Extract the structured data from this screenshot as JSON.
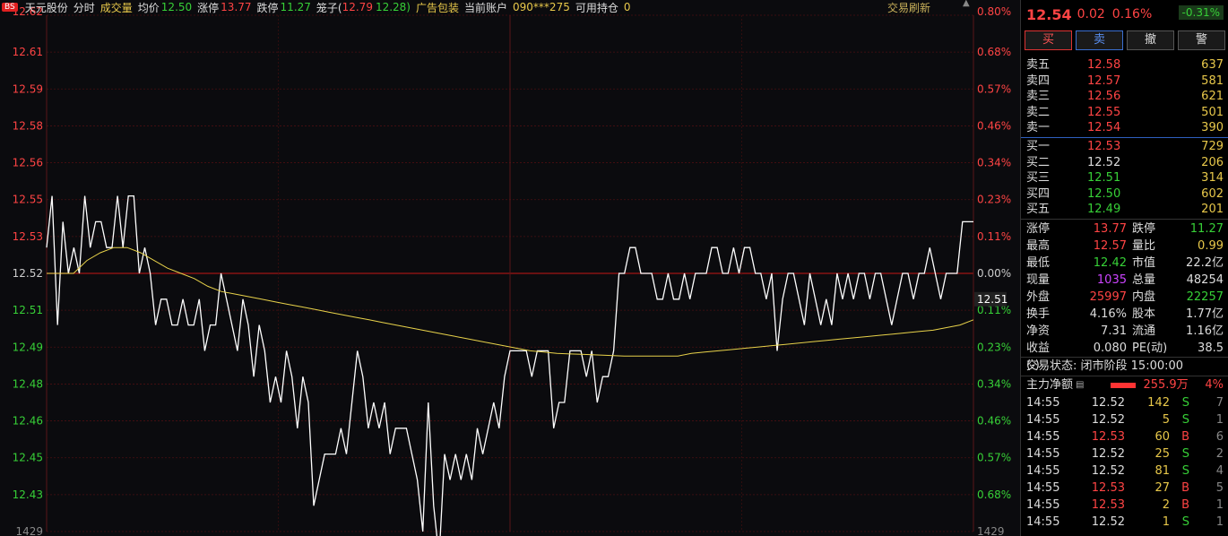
{
  "header": {
    "bs_tag": "BS",
    "stock_name": "天元股份",
    "view_mode": "分时",
    "indicator": "成交量",
    "avg_label": "均价",
    "avg_value": "12.50",
    "limit_up_label": "涨停",
    "limit_up_value": "13.77",
    "limit_down_label": "跌停",
    "limit_down_value": "11.27",
    "cage_label": "笼子(",
    "cage_high": "12.79",
    "cage_low": "12.28)",
    "ad_label": "广告包装",
    "account_label": "当前账户",
    "account_value": "090***275",
    "holding_label": "可用持仓",
    "holding_value": "0",
    "refresh_label": "交易刷新"
  },
  "chart": {
    "left_axis": [
      "12.62",
      "12.61",
      "12.59",
      "12.58",
      "12.56",
      "12.55",
      "12.53",
      "12.52",
      "12.51",
      "12.49",
      "12.48",
      "12.46",
      "12.45",
      "12.43",
      "1429"
    ],
    "right_axis": [
      "0.80%",
      "0.68%",
      "0.57%",
      "0.46%",
      "0.34%",
      "0.23%",
      "0.11%",
      "0.00%",
      "0.11%",
      "0.23%",
      "0.34%",
      "0.46%",
      "0.57%",
      "0.68%",
      "1429"
    ],
    "current_price_tag": "12.51",
    "y_min": 12.42,
    "y_max": 12.62,
    "price_points": [
      12.53,
      12.55,
      12.5,
      12.54,
      12.52,
      12.53,
      12.52,
      12.55,
      12.53,
      12.54,
      12.54,
      12.53,
      12.53,
      12.55,
      12.53,
      12.55,
      12.55,
      12.52,
      12.53,
      12.52,
      12.5,
      12.51,
      12.51,
      12.5,
      12.5,
      12.51,
      12.5,
      12.5,
      12.51,
      12.49,
      12.5,
      12.5,
      12.52,
      12.51,
      12.5,
      12.49,
      12.51,
      12.5,
      12.48,
      12.5,
      12.49,
      12.47,
      12.48,
      12.47,
      12.49,
      12.48,
      12.46,
      12.48,
      12.47,
      12.43,
      12.44,
      12.45,
      12.45,
      12.45,
      12.46,
      12.45,
      12.47,
      12.49,
      12.48,
      12.46,
      12.47,
      12.46,
      12.47,
      12.45,
      12.46,
      12.46,
      12.46,
      12.45,
      12.44,
      12.42,
      12.47,
      12.43,
      12.41,
      12.45,
      12.44,
      12.45,
      12.44,
      12.45,
      12.44,
      12.46,
      12.45,
      12.46,
      12.47,
      12.46,
      12.48,
      12.49,
      12.49,
      12.49,
      12.49,
      12.48,
      12.49,
      12.49,
      12.49,
      12.46,
      12.47,
      12.47,
      12.49,
      12.49,
      12.49,
      12.48,
      12.49,
      12.47,
      12.48,
      12.48,
      12.49,
      12.52,
      12.52,
      12.53,
      12.53,
      12.52,
      12.52,
      12.52,
      12.51,
      12.51,
      12.52,
      12.51,
      12.51,
      12.52,
      12.51,
      12.52,
      12.52,
      12.52,
      12.53,
      12.53,
      12.52,
      12.52,
      12.53,
      12.52,
      12.53,
      12.53,
      12.52,
      12.52,
      12.51,
      12.52,
      12.49,
      12.51,
      12.52,
      12.52,
      12.51,
      12.5,
      12.52,
      12.51,
      12.5,
      12.51,
      12.5,
      12.52,
      12.51,
      12.52,
      12.51,
      12.52,
      12.52,
      12.51,
      12.52,
      12.52,
      12.51,
      12.5,
      12.51,
      12.52,
      12.52,
      12.51,
      12.52,
      12.52,
      12.53,
      12.52,
      12.51,
      12.52,
      12.52,
      12.52,
      12.54,
      12.54,
      12.54
    ],
    "avg_points": [
      12.52,
      12.52,
      12.52,
      12.525,
      12.528,
      12.53,
      12.53,
      12.528,
      12.525,
      12.522,
      12.52,
      12.518,
      12.515,
      12.513,
      12.512,
      12.511,
      12.51,
      12.509,
      12.508,
      12.507,
      12.506,
      12.505,
      12.504,
      12.503,
      12.502,
      12.501,
      12.5,
      12.499,
      12.498,
      12.497,
      12.496,
      12.495,
      12.494,
      12.493,
      12.492,
      12.491,
      12.49,
      12.4895,
      12.489,
      12.4888,
      12.4886,
      12.4884,
      12.4882,
      12.488,
      12.488,
      12.488,
      12.488,
      12.488,
      12.489,
      12.4895,
      12.49,
      12.4905,
      12.491,
      12.4915,
      12.492,
      12.4925,
      12.493,
      12.4935,
      12.494,
      12.4945,
      12.495,
      12.4955,
      12.496,
      12.4965,
      12.497,
      12.4975,
      12.498,
      12.499,
      12.5,
      12.502
    ]
  },
  "quote": {
    "price": "12.54",
    "change": "0.02",
    "pct": "0.16%",
    "badge": "-0.31%",
    "buttons": [
      "买",
      "卖",
      "撤",
      "警"
    ]
  },
  "asks": [
    {
      "name": "卖五",
      "price": "12.58",
      "vol": "637"
    },
    {
      "name": "卖四",
      "price": "12.57",
      "vol": "581"
    },
    {
      "name": "卖三",
      "price": "12.56",
      "vol": "621"
    },
    {
      "name": "卖二",
      "price": "12.55",
      "vol": "501"
    },
    {
      "name": "卖一",
      "price": "12.54",
      "vol": "390"
    }
  ],
  "bids": [
    {
      "name": "买一",
      "price": "12.53",
      "vol": "729"
    },
    {
      "name": "买二",
      "price": "12.52",
      "vol": "206"
    },
    {
      "name": "买三",
      "price": "12.51",
      "vol": "314"
    },
    {
      "name": "买四",
      "price": "12.50",
      "vol": "602"
    },
    {
      "name": "买五",
      "price": "12.49",
      "vol": "201"
    }
  ],
  "stats": [
    {
      "l": "涨停",
      "lv": "13.77",
      "lc": "red",
      "r": "跌停",
      "rv": "11.27",
      "rc": "green"
    },
    {
      "l": "最高",
      "lv": "12.57",
      "lc": "red",
      "r": "量比",
      "rv": "0.99",
      "rc": "yellow"
    },
    {
      "l": "最低",
      "lv": "12.42",
      "lc": "green",
      "r": "市值",
      "rv": "22.2亿",
      "rc": "white"
    },
    {
      "l": "现量",
      "lv": "1035",
      "lc": "purple",
      "r": "总量",
      "rv": "48254",
      "rc": "white"
    },
    {
      "l": "外盘",
      "lv": "25997",
      "lc": "red",
      "r": "内盘",
      "rv": "22257",
      "rc": "green"
    },
    {
      "l": "换手",
      "lv": "4.16%",
      "lc": "white",
      "r": "股本",
      "rv": "1.77亿",
      "rc": "white"
    },
    {
      "l": "净资",
      "lv": "7.31",
      "lc": "white",
      "r": "流通",
      "rv": "1.16亿",
      "rc": "white"
    },
    {
      "l": "收益(-)",
      "lv": "0.080",
      "lc": "white",
      "r": "PE(动)",
      "rv": "38.5",
      "rc": "white"
    }
  ],
  "state": {
    "label": "交易状态:",
    "value": "闭市阶段 15:00:00"
  },
  "flow": {
    "label": "主力净额",
    "value": "255.9万",
    "pct": "4%"
  },
  "ticks": [
    {
      "t": "14:55",
      "p": "12.52",
      "pc": "white",
      "v": "142",
      "s": "S",
      "sc": "green",
      "c": "7"
    },
    {
      "t": "14:55",
      "p": "12.52",
      "pc": "white",
      "v": "5",
      "s": "S",
      "sc": "green",
      "c": "1"
    },
    {
      "t": "14:55",
      "p": "12.53",
      "pc": "red",
      "v": "60",
      "s": "B",
      "sc": "red",
      "c": "6"
    },
    {
      "t": "14:55",
      "p": "12.52",
      "pc": "white",
      "v": "25",
      "s": "S",
      "sc": "green",
      "c": "2"
    },
    {
      "t": "14:55",
      "p": "12.52",
      "pc": "white",
      "v": "81",
      "s": "S",
      "sc": "green",
      "c": "4"
    },
    {
      "t": "14:55",
      "p": "12.53",
      "pc": "red",
      "v": "27",
      "s": "B",
      "sc": "red",
      "c": "5"
    },
    {
      "t": "14:55",
      "p": "12.53",
      "pc": "red",
      "v": "2",
      "s": "B",
      "sc": "red",
      "c": "1"
    },
    {
      "t": "14:55",
      "p": "12.52",
      "pc": "white",
      "v": "1",
      "s": "S",
      "sc": "green",
      "c": "1"
    }
  ]
}
